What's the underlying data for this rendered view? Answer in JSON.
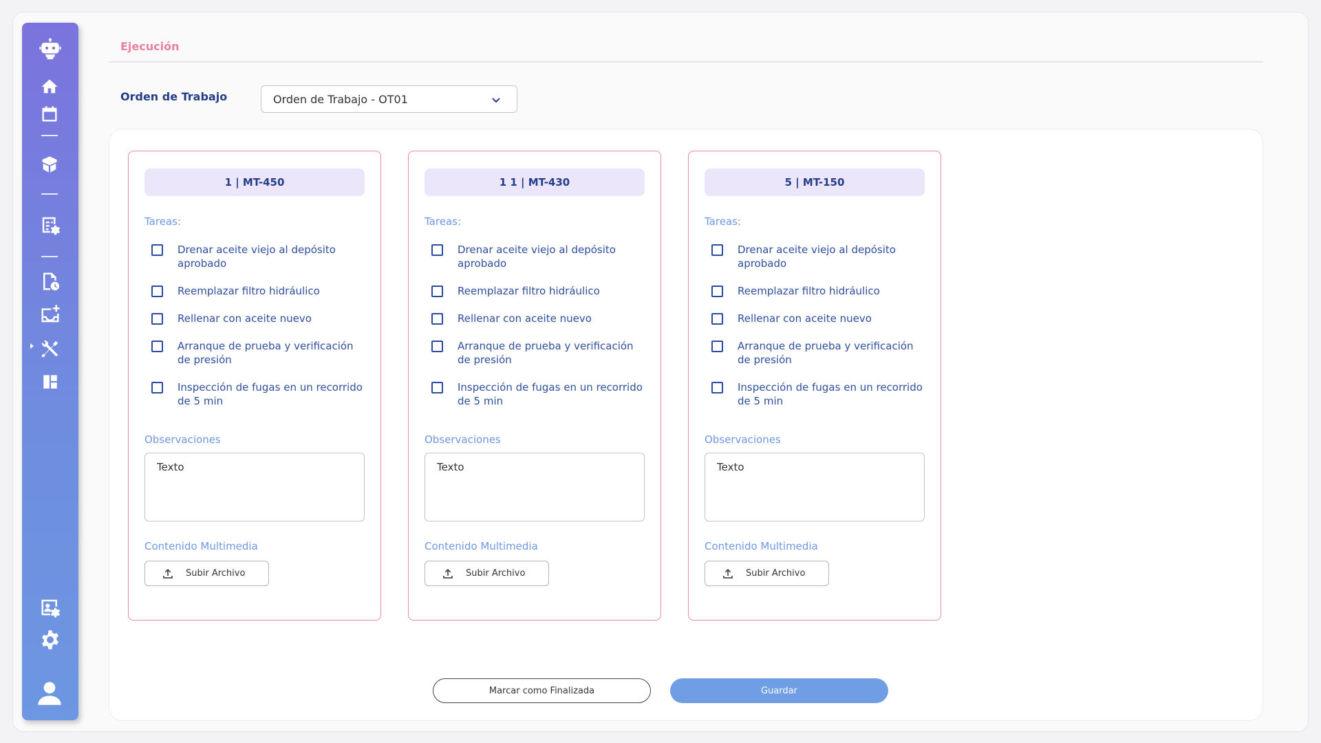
{
  "header": {
    "tab_title": "Ejecución"
  },
  "orden": {
    "label": "Orden de Trabajo",
    "selected": "Orden de Trabajo - OT01"
  },
  "colors": {
    "accent": "#233d8a",
    "pink": "#ea8aa4",
    "light_blue": "#6f98e2",
    "save": "#6f9ee5"
  },
  "sidebar": {
    "icons": [
      "robot-logo-icon",
      "home-icon",
      "calendar-icon",
      "box-icon",
      "report-settings-icon",
      "document-clock-icon",
      "inbox-add-icon",
      "tools-icon",
      "dashboard-icon",
      "user-settings-icon",
      "gear-icon",
      "user-icon"
    ],
    "active": "tools-icon"
  },
  "cards": [
    {
      "title": "1 | MT-450",
      "tasks_label": "Tareas:",
      "tasks": [
        "Drenar aceite viejo al depósito aprobado",
        "Reemplazar filtro hidráulico",
        "Rellenar con aceite nuevo",
        "Arranque de prueba y verificación de presión",
        "Inspección de fugas en un recorrido de 5 min"
      ],
      "obs_label": "Observaciones",
      "obs_text": "Texto",
      "media_label": "Contenido Multimedia",
      "upload_label": "Subir Archivo"
    },
    {
      "title": "1 1 | MT-430",
      "tasks_label": "Tareas:",
      "tasks": [
        "Drenar aceite viejo al depósito aprobado",
        "Reemplazar filtro hidráulico",
        "Rellenar con aceite nuevo",
        "Arranque de prueba y verificación de presión",
        "Inspección de fugas en un recorrido de 5 min"
      ],
      "obs_label": "Observaciones",
      "obs_text": "Texto",
      "media_label": "Contenido Multimedia",
      "upload_label": "Subir Archivo"
    },
    {
      "title": "5 | MT-150",
      "tasks_label": "Tareas:",
      "tasks": [
        "Drenar aceite viejo al depósito aprobado",
        "Reemplazar filtro hidráulico",
        "Rellenar con aceite nuevo",
        "Arranque de prueba y verificación de presión",
        "Inspección de fugas en un recorrido de 5 min"
      ],
      "obs_label": "Observaciones",
      "obs_text": "Texto",
      "media_label": "Contenido Multimedia",
      "upload_label": "Subir Archivo"
    }
  ],
  "actions": {
    "finalize_label": "Marcar como Finalizada",
    "save_label": "Guardar"
  }
}
